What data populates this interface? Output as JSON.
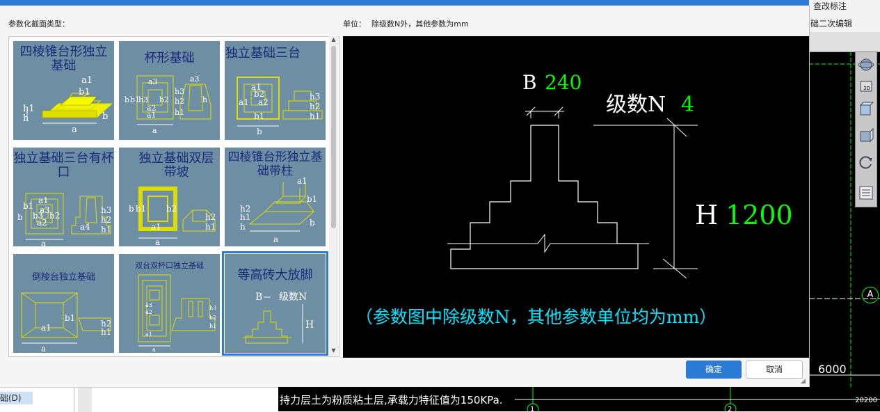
{
  "background": {
    "toolbar_top": "查改标注",
    "toolbar_second": "础二次编辑",
    "left_panel_item": "础(D)",
    "cad_text": "持力层土为粉质粘土层,承载力特征值为150KPa.",
    "axis_label": "A",
    "dim_6000": "6000",
    "dim_20200": "20200",
    "axis_1": "1",
    "axis_2": "2"
  },
  "dialog": {
    "section_label": "参数化截面类型：",
    "unit_label": "单位：",
    "unit_text": "除级数N外，其他参数为mm",
    "ok_label": "确定",
    "cancel_label": "取消"
  },
  "tiles": [
    {
      "title": "四棱锥台形独立基础",
      "labels": [
        "a1",
        "b1",
        "h1",
        "h",
        "b",
        "a"
      ]
    },
    {
      "title": "杯形基础",
      "labels": [
        "a3",
        "a2",
        "b",
        "b1",
        "b3",
        "b2",
        "a1",
        "h3",
        "h2",
        "h1",
        "h",
        "a3",
        "a"
      ]
    },
    {
      "title": "独立基础三台",
      "labels": [
        "a1",
        "b2",
        "a2",
        "a1",
        "b1",
        "b",
        "h3",
        "h2",
        "h1"
      ]
    },
    {
      "title": "独立基础三台有杯口",
      "labels": [
        "a1",
        "a2",
        "a3",
        "b1",
        "b3",
        "b2",
        "b",
        "a4",
        "h3",
        "h2",
        "h1",
        "a"
      ]
    },
    {
      "title": "独立基础双层带坡",
      "labels": [
        "b",
        "b1",
        "b2",
        "a1",
        "h2",
        "h1",
        "a"
      ]
    },
    {
      "title": "四棱锥台形独立基础带柱",
      "labels": [
        "a1",
        "b1",
        "h2",
        "h1",
        "h",
        "a",
        "b"
      ]
    },
    {
      "title": "倒棱台独立基础",
      "labels": [
        "b1",
        "a1",
        "h2",
        "h1",
        "a"
      ]
    },
    {
      "title": "双台双杯口独立基础",
      "labels": [
        "a3",
        "a2",
        "a1",
        "h3",
        "h2",
        "h1",
        "a"
      ]
    },
    {
      "title": "等高砖大放脚",
      "labels": [
        "B",
        "级数N",
        "H"
      ]
    }
  ],
  "preview": {
    "B_label": "B",
    "B_value": "240",
    "N_label": "级数N",
    "N_value": "4",
    "H_label": "H",
    "H_value": "1200",
    "note": "（参数图中除级数N，其他参数单位均为mm）",
    "colors": {
      "value": "#00ff00",
      "label": "#ffffff",
      "note": "#00e5ff",
      "line": "#ffffff"
    }
  }
}
